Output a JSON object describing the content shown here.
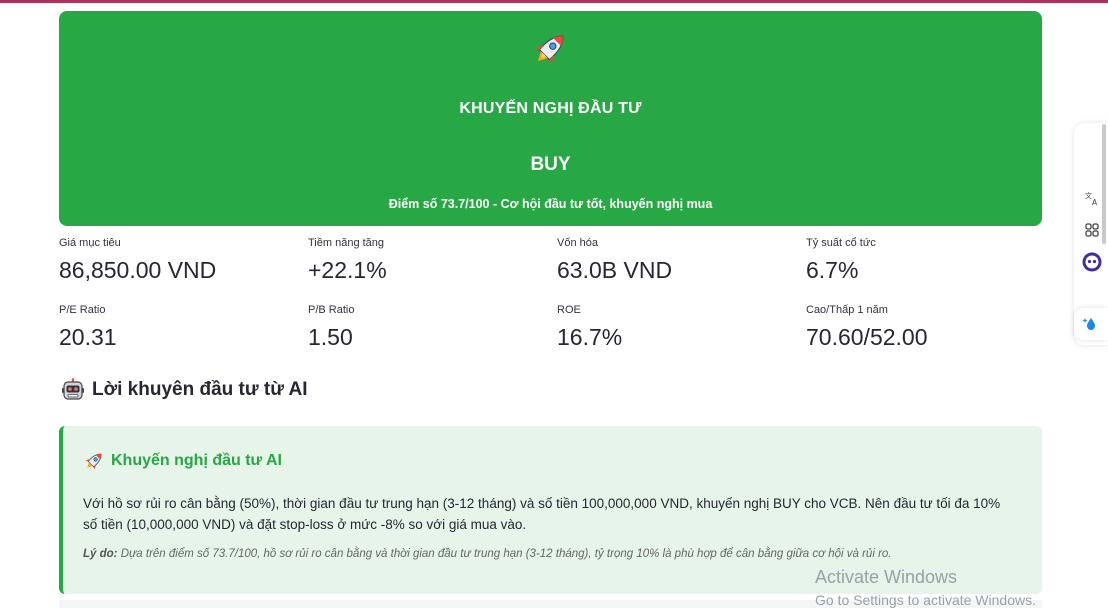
{
  "hero": {
    "icon": "rocket-icon",
    "title": "KHUYẾN NGHỊ ĐẦU TƯ",
    "recommendation": "BUY",
    "description": "Điểm số 73.7/100 - Cơ hội đầu tư tốt, khuyến nghị mua",
    "color": "#28a745"
  },
  "metrics": [
    {
      "label": "Giá mục tiêu",
      "value": "86,850.00 VND"
    },
    {
      "label": "Tiềm năng tăng",
      "value": "+22.1%"
    },
    {
      "label": "Vốn hóa",
      "value": "63.0B VND"
    },
    {
      "label": "Tỷ suất cổ tức",
      "value": "6.7%"
    },
    {
      "label": "P/E Ratio",
      "value": "20.31"
    },
    {
      "label": "P/B Ratio",
      "value": "1.50"
    },
    {
      "label": "ROE",
      "value": "16.7%"
    },
    {
      "label": "Cao/Thấp 1 năm",
      "value": "70.60/52.00"
    }
  ],
  "ai_section": {
    "icon": "robot-icon",
    "title": "Lời khuyên đầu tư từ AI"
  },
  "advice": {
    "icon": "rocket-icon",
    "title": "Khuyến nghị đầu tư AI",
    "body": "Với hồ sơ rủi ro cân bằng (50%), thời gian đầu tư trung hạn (3-12 tháng) và số tiền 100,000,000 VND, khuyến nghị BUY cho VCB. Nên đầu tư tối đa 10% số tiền (10,000,000 VND) và đặt stop-loss ở mức -8% so với giá mua vào.",
    "reason_label": "Lý do:",
    "reason_text": "Dựa trên điểm số 73.7/100, hồ sơ rủi ro cân bằng và thời gian đầu tư trung hạn (3-12 tháng), tỷ trọng 10% là phù hợp để cân bằng giữa cơ hội và rủi ro.",
    "background": "#e6f4ea",
    "accent": "#28a745"
  },
  "side_dock": {
    "items": [
      "translate-icon",
      "apps-grid-icon",
      "assistant-face-icon",
      "water-drop-sparkle-icon"
    ]
  },
  "watermark": {
    "line1": "Activate Windows",
    "line2": "Go to Settings to activate Windows."
  }
}
